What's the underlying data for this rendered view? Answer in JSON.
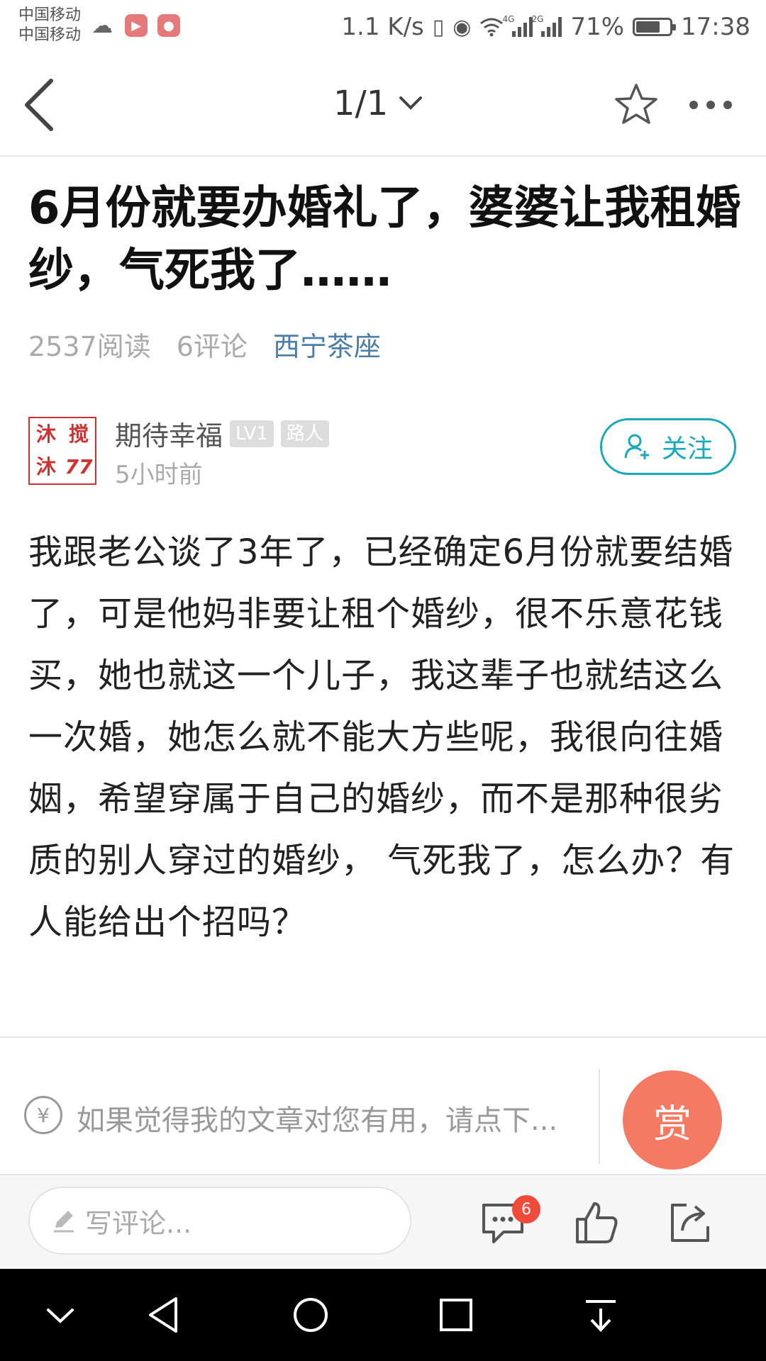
{
  "status_bar": {
    "carrier1": "中国移动",
    "carrier2": "中国移动",
    "speed": "1.1 K/s",
    "net1": "4G",
    "net2": "2G",
    "battery": "71%",
    "battery_level": 0.71,
    "time": "17:38"
  },
  "nav": {
    "page_indicator": "1/1"
  },
  "article": {
    "title": "6月份就要办婚礼了，婆婆让我租婚纱，气死我了……",
    "reads": "2537阅读",
    "comments": "6评论",
    "forum": "西宁茶座",
    "author": "期待幸福",
    "level_badge": "LV1",
    "role_badge": "路人",
    "time": "5小时前",
    "avatar_chars": [
      "沐",
      "搅",
      "沐",
      "77"
    ],
    "follow_label": "关注",
    "body": "我跟老公谈了3年了，已经确定6月份就要结婚了，可是他妈非要让租个婚纱，很不乐意花钱买，她也就这一个儿子，我这辈子也就结这么一次婚，她怎么就不能大方些呢，我很向往婚姻，希望穿属于自己的婚纱，而不是那种很劣质的别人穿过的婚纱， 气死我了，怎么办？有人能给出个招吗？"
  },
  "reward": {
    "yen": "¥",
    "text": "如果觉得我的文章对您有用，请点下...",
    "button": "赏"
  },
  "bottom_bar": {
    "comment_placeholder": "写评论...",
    "comment_count": "6"
  },
  "colors": {
    "accent_teal": "#1aa9b8",
    "forum_link": "#4a7ea8",
    "reward_button": "#f47a64",
    "badge_red": "#f04a3a"
  }
}
